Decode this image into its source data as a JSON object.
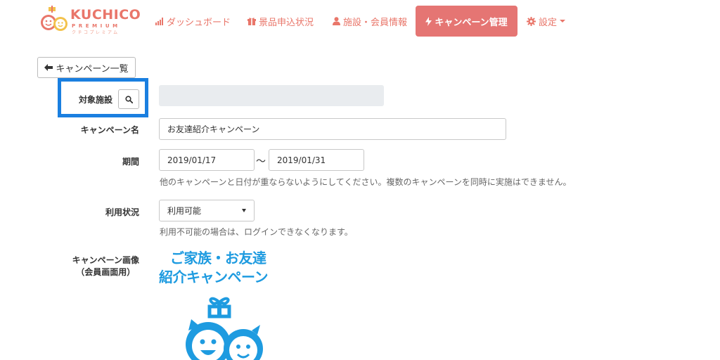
{
  "brand": {
    "name": "KUCHICO",
    "tagline": "PREMIUM",
    "kana": "クチコプレミアム",
    "color": "#e9766a"
  },
  "nav": {
    "dashboard": "ダッシュボード",
    "prizes": "景品申込状況",
    "facility": "施設・会員情報",
    "campaign": "キャンペーン管理",
    "settings": "設定",
    "active_bg": "#e57573"
  },
  "back_button": "キャンペーン一覧",
  "form": {
    "facility_label": "対象施設",
    "facility_value": "",
    "name_label": "キャンペーン名",
    "name_value": "お友達紹介キャンペーン",
    "period_label": "期間",
    "period_start": "2019/01/17",
    "period_separator": "〜",
    "period_end": "2019/01/31",
    "period_help": "他のキャンペーンと日付が重ならないようにしてください。複数のキャンペーンを同時に実施はできません。",
    "status_label": "利用状況",
    "status_value": "利用可能",
    "status_help": "利用不可能の場合は、ログインできなくなります。",
    "image_label_line1": "キャンペーン画像",
    "image_label_line2": "（会員画面用）"
  },
  "campaign_image": {
    "line1": "ご家族・お友達",
    "line2": "紹介キャンペーン",
    "color": "#1e9be0"
  },
  "highlight_color": "#1a7fe0",
  "icons": {
    "dashboard": "bar-chart-icon",
    "prizes": "gift-icon",
    "facility": "user-icon",
    "campaign": "lightning-icon",
    "settings": "gear-icon",
    "back": "arrow-left-icon",
    "search": "search-icon"
  }
}
